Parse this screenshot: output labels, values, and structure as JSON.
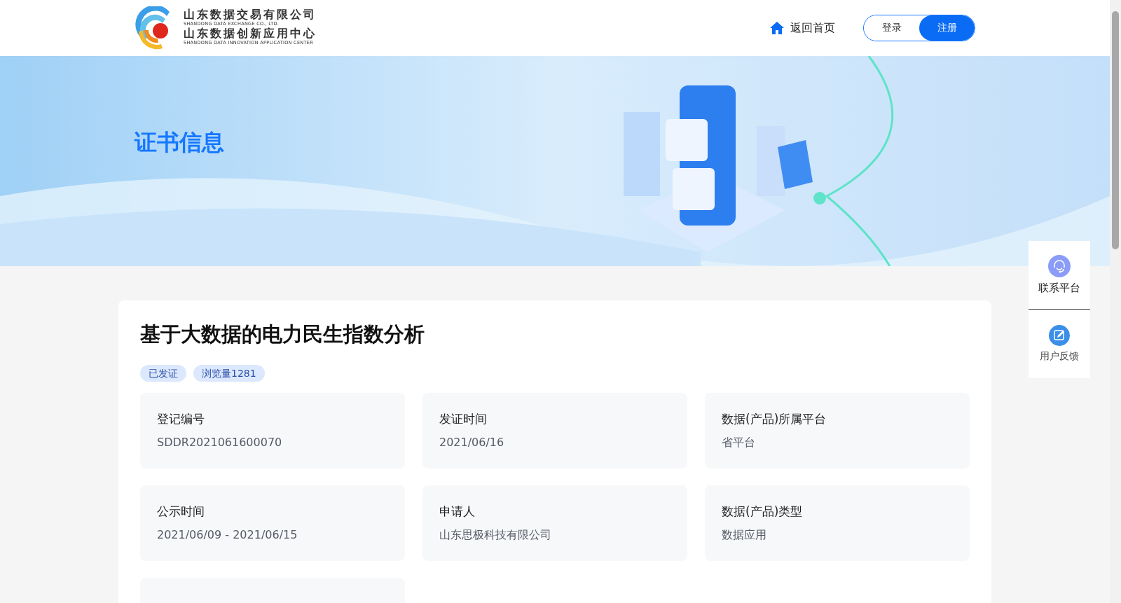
{
  "header": {
    "logo_lines": [
      "山东数据交易有限公司",
      "SHANDONG DATA EXCHANGE CO., LTD.",
      "山东数据创新应用中心",
      "SHANDONG DATA INNOVATION APPLICATION CENTER"
    ],
    "home_link": "返回首页",
    "auth_buttons": [
      {
        "label": "登录",
        "selected": false
      },
      {
        "label": "注册",
        "selected": true
      }
    ]
  },
  "banner": {
    "title": "证书信息"
  },
  "certificate": {
    "title": "基于大数据的电力民生指数分析",
    "tags": [
      "已发证",
      "浏览量1281"
    ],
    "fields": [
      {
        "label": "登记编号",
        "value": "SDDR2021061600070"
      },
      {
        "label": "发证时间",
        "value": "2021/06/16"
      },
      {
        "label": "数据(产品)所属平台",
        "value": "省平台"
      },
      {
        "label": "公示时间",
        "value": "2021/06/09 - 2021/06/15"
      },
      {
        "label": "申请人",
        "value": "山东思极科技有限公司"
      },
      {
        "label": "数据(产品)类型",
        "value": "数据应用"
      }
    ]
  },
  "side_float": [
    {
      "kind": "contact",
      "label": "联系平台"
    },
    {
      "kind": "feedback",
      "label": "用户反馈"
    }
  ]
}
